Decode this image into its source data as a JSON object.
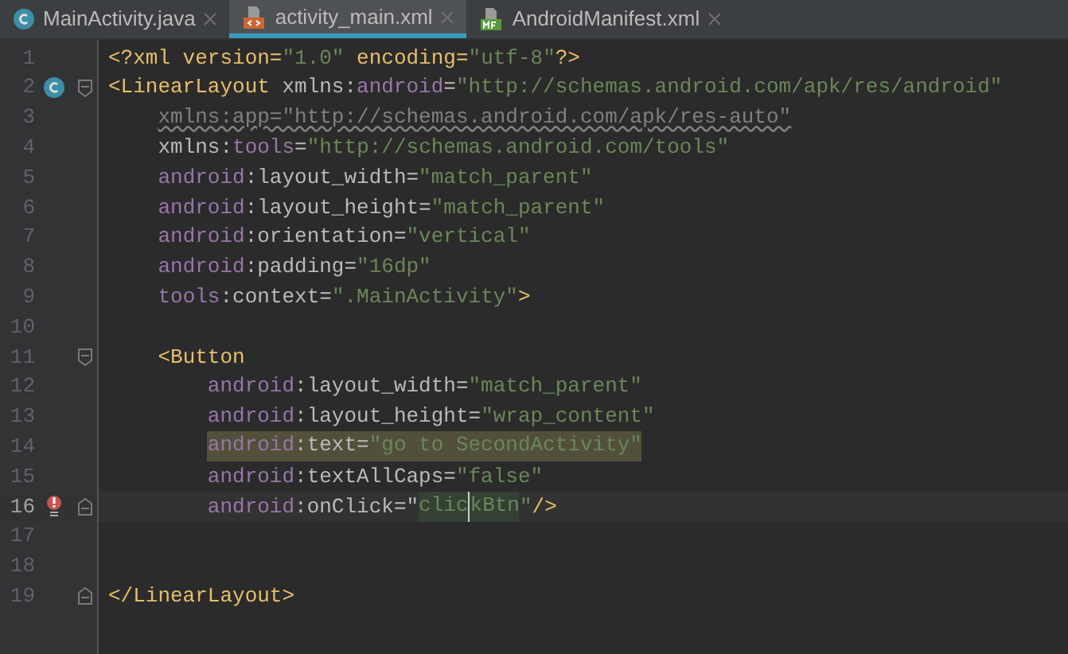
{
  "tabs": [
    {
      "label": "MainActivity.java",
      "kind": "java",
      "selected": false
    },
    {
      "label": "activity_main.xml",
      "kind": "xml",
      "selected": true
    },
    {
      "label": "AndroidManifest.xml",
      "kind": "manifest",
      "selected": false
    }
  ],
  "editor": {
    "lines": [
      {
        "number": "1",
        "tokens": [
          {
            "text": "<?xml version=",
            "kind": "tag"
          },
          {
            "text": "\"1.0\"",
            "kind": "string"
          },
          {
            "text": " encoding=",
            "kind": "tag"
          },
          {
            "text": "\"utf-8\"",
            "kind": "string"
          },
          {
            "text": "?>",
            "kind": "tag"
          }
        ]
      },
      {
        "number": "2",
        "class_marker": true,
        "fold_start": true,
        "tokens": [
          {
            "text": "<LinearLayout ",
            "kind": "tag"
          },
          {
            "text": "xmlns:",
            "kind": "attr"
          },
          {
            "text": "android",
            "kind": "ns"
          },
          {
            "text": "=",
            "kind": "attr"
          },
          {
            "text": "\"http://schemas.android.com/apk/res/android\"",
            "kind": "string"
          }
        ]
      },
      {
        "number": "3",
        "tokens": [
          {
            "text": "    xmlns:app=\"http://schemas.android.com/apk/res-auto\"",
            "kind": "unused"
          }
        ]
      },
      {
        "number": "4",
        "tokens": [
          {
            "text": "    xmlns:",
            "kind": "attr"
          },
          {
            "text": "tools",
            "kind": "ns"
          },
          {
            "text": "=",
            "kind": "attr"
          },
          {
            "text": "\"http://schemas.android.com/tools\"",
            "kind": "string"
          }
        ]
      },
      {
        "number": "5",
        "tokens": [
          {
            "text": "    android",
            "kind": "ns"
          },
          {
            "text": ":layout_width=",
            "kind": "attr"
          },
          {
            "text": "\"match_parent\"",
            "kind": "string"
          }
        ]
      },
      {
        "number": "6",
        "tokens": [
          {
            "text": "    android",
            "kind": "ns"
          },
          {
            "text": ":layout_height=",
            "kind": "attr"
          },
          {
            "text": "\"match_parent\"",
            "kind": "string"
          }
        ]
      },
      {
        "number": "7",
        "tokens": [
          {
            "text": "    android",
            "kind": "ns"
          },
          {
            "text": ":orientation=",
            "kind": "attr"
          },
          {
            "text": "\"vertical\"",
            "kind": "string"
          }
        ]
      },
      {
        "number": "8",
        "tokens": [
          {
            "text": "    android",
            "kind": "ns"
          },
          {
            "text": ":padding=",
            "kind": "attr"
          },
          {
            "text": "\"16dp\"",
            "kind": "string"
          }
        ]
      },
      {
        "number": "9",
        "tokens": [
          {
            "text": "    tools",
            "kind": "ns"
          },
          {
            "text": ":context=",
            "kind": "attr"
          },
          {
            "text": "\".MainActivity\"",
            "kind": "string"
          },
          {
            "text": ">",
            "kind": "tag"
          }
        ]
      },
      {
        "number": "10"
      },
      {
        "number": "11",
        "fold_start": true,
        "tokens": [
          {
            "text": "    <Button",
            "kind": "tag"
          }
        ]
      },
      {
        "number": "12",
        "tokens": [
          {
            "text": "        android",
            "kind": "ns"
          },
          {
            "text": ":layout_width=",
            "kind": "attr"
          },
          {
            "text": "\"match_parent\"",
            "kind": "string"
          }
        ]
      },
      {
        "number": "13",
        "tokens": [
          {
            "text": "        android",
            "kind": "ns"
          },
          {
            "text": ":layout_height=",
            "kind": "attr"
          },
          {
            "text": "\"wrap_content\"",
            "kind": "string"
          }
        ]
      },
      {
        "number": "14",
        "tokens": [
          {
            "text": "        android",
            "kind": "ns",
            "highlighted": true
          },
          {
            "text": ":text=",
            "kind": "attr",
            "highlighted": true
          },
          {
            "text": "\"go to SecondActivity\"",
            "kind": "string",
            "highlighted": true
          }
        ]
      },
      {
        "number": "15",
        "tokens": [
          {
            "text": "        android",
            "kind": "ns"
          },
          {
            "text": ":textAllCaps=",
            "kind": "attr"
          },
          {
            "text": "\"false\"",
            "kind": "string"
          }
        ]
      },
      {
        "number": "16",
        "current": true,
        "error": true,
        "fold_end": true,
        "tokens": [
          {
            "text": "        android",
            "kind": "ns"
          },
          {
            "text": ":onClick=\"",
            "kind": "attr"
          },
          {
            "text": "clic",
            "kind": "string",
            "matched": true
          },
          {
            "text": "kBtn",
            "kind": "string",
            "matched": true,
            "caret_before": true
          },
          {
            "text": "\"",
            "kind": "string"
          },
          {
            "text": "/>",
            "kind": "tag"
          }
        ]
      },
      {
        "number": "17"
      },
      {
        "number": "18"
      },
      {
        "number": "19",
        "fold_end": true,
        "tokens": [
          {
            "text": "</LinearLayout>",
            "kind": "tag"
          }
        ]
      }
    ]
  }
}
